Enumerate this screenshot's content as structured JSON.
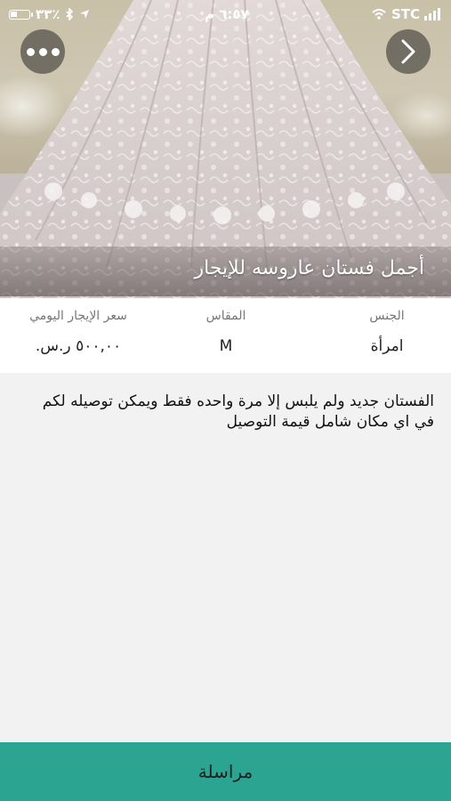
{
  "status_bar": {
    "carrier": "STC",
    "time": "٦:٥٧ م",
    "battery": "٣٣٪",
    "icons": [
      "wifi-icon",
      "signal-icon",
      "location-arrow-icon",
      "bluetooth-icon",
      "battery-icon"
    ]
  },
  "header": {
    "more_icon": "more-dots-icon",
    "next_icon": "chevron-right-icon"
  },
  "listing": {
    "title": "أجمل فستان عاروسه للإيجار"
  },
  "specs": {
    "gender_label": "الجنس",
    "gender_value": "امرأة",
    "size_label": "المقاس",
    "size_value": "M",
    "price_label": "سعر الإيجار اليومي",
    "price_value": "٥٠٠,٠٠ ر.س."
  },
  "description": {
    "text": "الفستان جديد ولم يلبس إلا مرة واحده فقط ويمكن توصيله لكم في اي مكان شامل قيمة التوصيل"
  },
  "actions": {
    "contact_label": "مراسلة"
  },
  "colors": {
    "accent": "#2ba591",
    "background": "#f2f2f2"
  }
}
